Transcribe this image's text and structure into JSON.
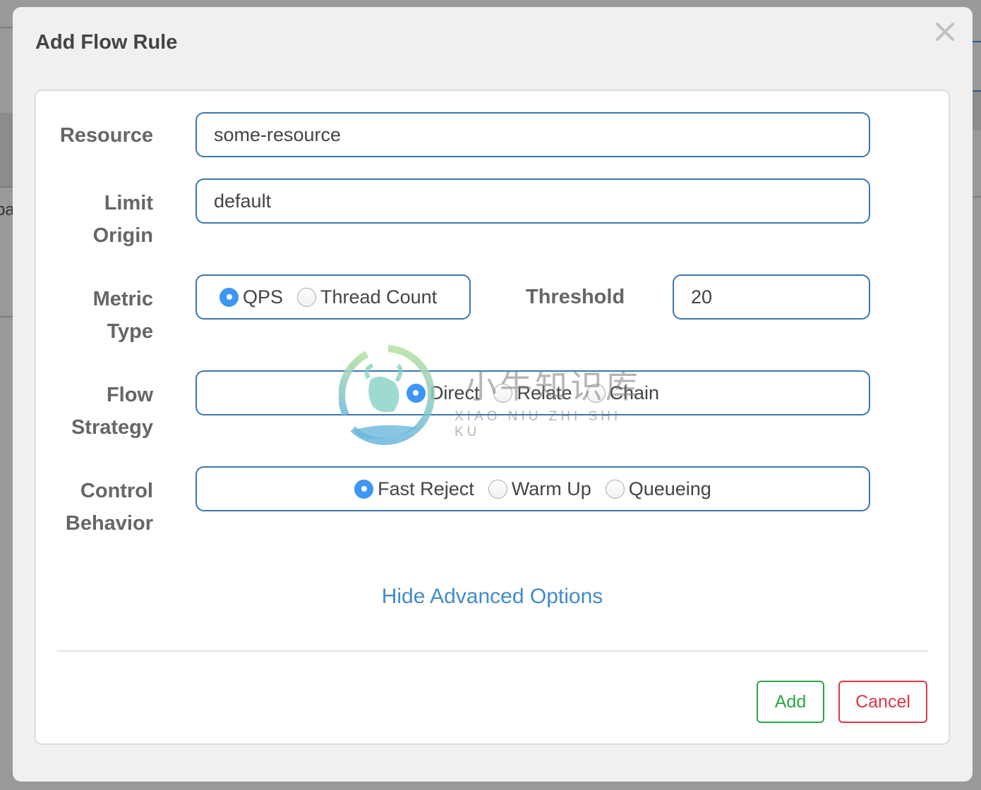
{
  "background": {
    "partial_text": "pa"
  },
  "modal": {
    "title": "Add Flow Rule",
    "close_icon": "close-icon"
  },
  "form": {
    "resource": {
      "label": "Resource",
      "value": "some-resource"
    },
    "limit_origin": {
      "label_line1": "Limit",
      "label_line2": "Origin",
      "value": "default"
    },
    "metric_type": {
      "label_line1": "Metric",
      "label_line2": "Type",
      "options": [
        {
          "label": "QPS",
          "checked": true
        },
        {
          "label": "Thread Count",
          "checked": false
        }
      ]
    },
    "threshold": {
      "label": "Threshold",
      "value": "20"
    },
    "flow_strategy": {
      "label_line1": "Flow",
      "label_line2": "Strategy",
      "options": [
        {
          "label": "Direct",
          "checked": true
        },
        {
          "label": "Relate",
          "checked": false
        },
        {
          "label": "Chain",
          "checked": false
        }
      ]
    },
    "control_behavior": {
      "label_line1": "Control",
      "label_line2": "Behavior",
      "options": [
        {
          "label": "Fast Reject",
          "checked": true
        },
        {
          "label": "Warm Up",
          "checked": false
        },
        {
          "label": "Queueing",
          "checked": false
        }
      ]
    }
  },
  "advanced_link": "Hide Advanced Options",
  "buttons": {
    "add": "Add",
    "cancel": "Cancel"
  },
  "watermark": {
    "chinese": "小牛知识库",
    "pinyin": "XIAO NIU ZHI SHI KU"
  },
  "colors": {
    "primary_link": "#428bca",
    "input_border": "#3a76ae",
    "radio_checked": "#3d96f3",
    "add_green": "#28a745",
    "cancel_red": "#dc3545"
  }
}
